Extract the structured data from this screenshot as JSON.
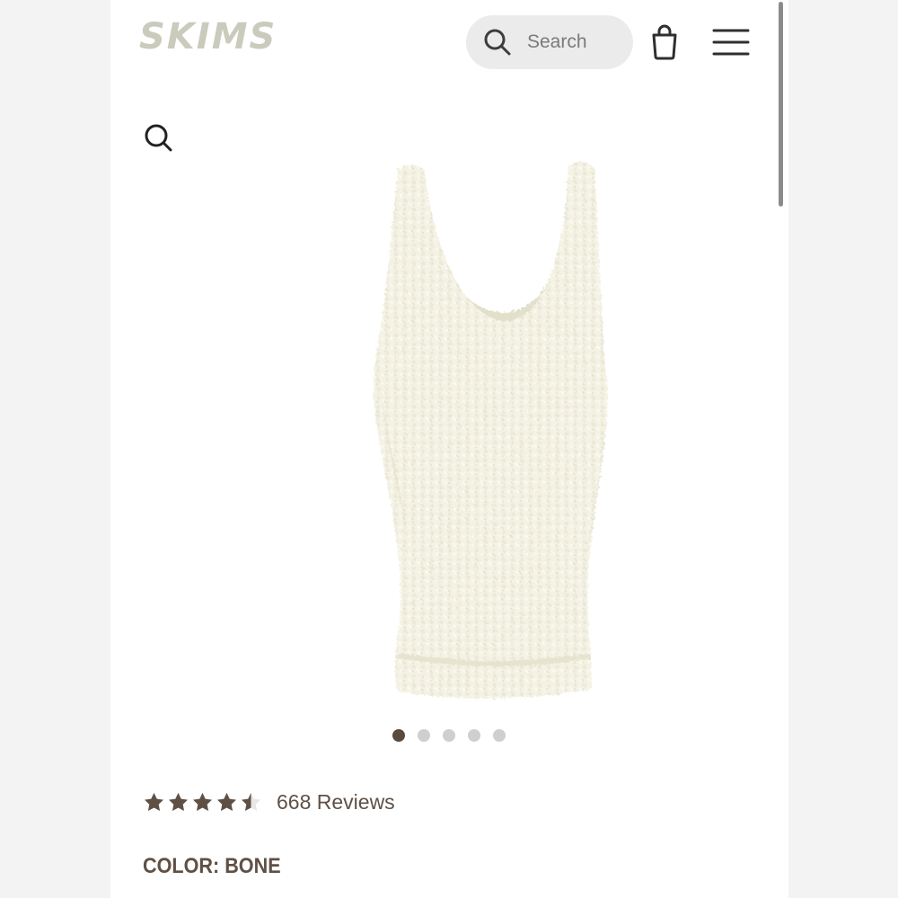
{
  "header": {
    "logo_text": "SKIMS",
    "search_label": "Search",
    "icons": [
      "search-icon",
      "shopping-bag-icon",
      "hamburger-menu-icon"
    ]
  },
  "gallery": {
    "zoom_icon": "magnifier-icon",
    "slide_count": 5,
    "active_slide": 1
  },
  "product": {
    "rating": 4.5,
    "rating_max": 5,
    "reviews_text": "668 Reviews",
    "color_label": "COLOR:",
    "color_value": "BONE"
  },
  "colors": {
    "logo": "#cbcbbd",
    "accent_text": "#5f5045",
    "active_dot": "#5b4b3e",
    "inactive_dot": "#cfcfd2",
    "garment": "#f3f1e2"
  }
}
